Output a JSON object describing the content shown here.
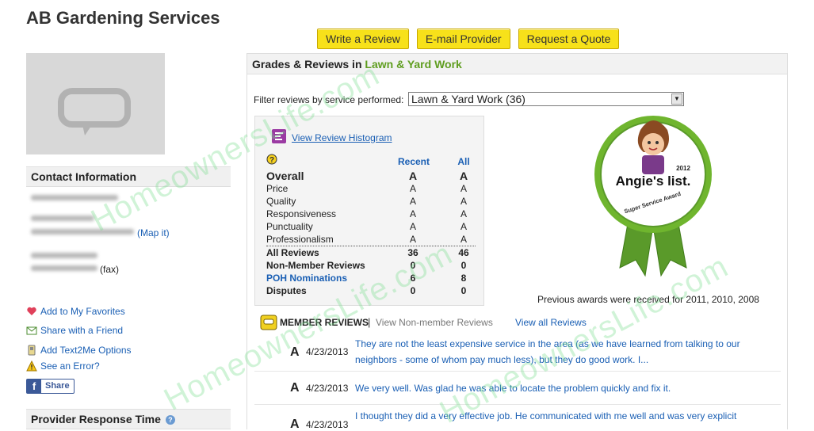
{
  "page": {
    "title": "AB Gardening Services"
  },
  "actions": {
    "write_review": "Write a Review",
    "email_provider": "E-mail Provider",
    "request_quote": "Request a Quote"
  },
  "contact": {
    "heading": "Contact Information",
    "map_link": "(Map it)",
    "fax_label": "(fax)"
  },
  "side_links": [
    {
      "icon": "heart-icon",
      "label": "Add to My Favorites"
    },
    {
      "icon": "envelope-icon",
      "label": "Share with a Friend"
    },
    {
      "icon": "phone-icon",
      "label": "Add Text2Me Options"
    },
    {
      "icon": "warning-icon",
      "label": "See an Error?"
    }
  ],
  "facebook": {
    "label": "Share"
  },
  "response_time": {
    "heading": "Provider Response Time"
  },
  "reviews_panel": {
    "heading_prefix": "Grades & Reviews in",
    "heading_category": "Lawn & Yard Work",
    "filter_label": "Filter reviews by service performed:",
    "filter_value": "Lawn & Yard Work (36)",
    "histogram_link": "View Review Histogram",
    "col_recent": "Recent",
    "col_all": "All",
    "grades": [
      {
        "label": "Overall",
        "recent": "A",
        "all": "A"
      },
      {
        "label": "Price",
        "recent": "A",
        "all": "A"
      },
      {
        "label": "Quality",
        "recent": "A",
        "all": "A"
      },
      {
        "label": "Responsiveness",
        "recent": "A",
        "all": "A"
      },
      {
        "label": "Punctuality",
        "recent": "A",
        "all": "A"
      },
      {
        "label": "Professionalism",
        "recent": "A",
        "all": "A"
      }
    ],
    "counts": [
      {
        "label": "All Reviews",
        "recent": "36",
        "all": "46"
      },
      {
        "label": "Non-Member Reviews",
        "recent": "0",
        "all": "0"
      },
      {
        "label": "POH Nominations",
        "recent": "6",
        "all": "8"
      },
      {
        "label": "Disputes",
        "recent": "0",
        "all": "0"
      }
    ],
    "award": {
      "year": "2012",
      "brand": "Angie's list.",
      "ribbon": "Super Service Award",
      "previous": "Previous awards were received for 2011, 2010, 2008"
    },
    "member_reviews": {
      "label": "MEMBER REVIEWS",
      "separator": "|",
      "non_member_link": "View Non-member Reviews",
      "all_link": "View all Reviews"
    },
    "reviews": [
      {
        "grade": "A",
        "date": "4/23/2013",
        "text": "They are not the least expensive service in the area (as we have learned from talking to our neighbors - some of whom pay much less), but they do good work. I..."
      },
      {
        "grade": "A",
        "date": "4/23/2013",
        "text": "We very well. Was glad he was able to locate the problem  quickly and fix it."
      },
      {
        "grade": "A",
        "date": "4/23/2013",
        "text": "I thought they did a very effective job. He communicated with me well and was very explicit"
      }
    ]
  },
  "watermark": {
    "text": "HomeownersLife.com"
  },
  "colors": {
    "accent_green": "#5e9d1e",
    "button_yellow": "#f7e11a",
    "link_blue": "#1a5fb4"
  }
}
